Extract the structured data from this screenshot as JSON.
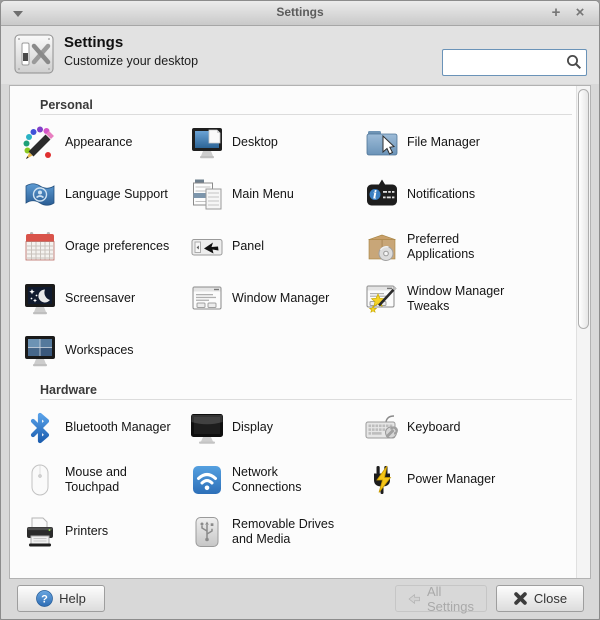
{
  "window": {
    "title": "Settings",
    "maximize_glyph": "+",
    "close_glyph": "×"
  },
  "header": {
    "title": "Settings",
    "subtitle": "Customize your desktop",
    "search_value": ""
  },
  "sections": [
    {
      "title": "Personal",
      "items": [
        {
          "label": "Appearance",
          "icon": "appearance-icon"
        },
        {
          "label": "Desktop",
          "icon": "desktop-icon"
        },
        {
          "label": "File Manager",
          "icon": "file-manager-icon"
        },
        {
          "label": "Language Support",
          "icon": "language-support-icon"
        },
        {
          "label": "Main Menu",
          "icon": "main-menu-icon"
        },
        {
          "label": "Notifications",
          "icon": "notifications-icon"
        },
        {
          "label": "Orage preferences",
          "icon": "calendar-icon"
        },
        {
          "label": "Panel",
          "icon": "panel-icon"
        },
        {
          "label": "Preferred Applications",
          "icon": "preferred-applications-icon"
        },
        {
          "label": "Screensaver",
          "icon": "screensaver-icon"
        },
        {
          "label": "Window Manager",
          "icon": "window-manager-icon"
        },
        {
          "label": "Window Manager Tweaks",
          "icon": "window-manager-tweaks-icon"
        },
        {
          "label": "Workspaces",
          "icon": "workspaces-icon"
        }
      ]
    },
    {
      "title": "Hardware",
      "items": [
        {
          "label": "Bluetooth Manager",
          "icon": "bluetooth-icon"
        },
        {
          "label": "Display",
          "icon": "display-icon"
        },
        {
          "label": "Keyboard",
          "icon": "keyboard-icon"
        },
        {
          "label": "Mouse and Touchpad",
          "icon": "mouse-icon"
        },
        {
          "label": "Network Connections",
          "icon": "network-icon"
        },
        {
          "label": "Power Manager",
          "icon": "power-icon"
        },
        {
          "label": "Printers",
          "icon": "printer-icon"
        },
        {
          "label": "Removable Drives and Media",
          "icon": "removable-drive-icon"
        }
      ]
    }
  ],
  "footer": {
    "help_label": "Help",
    "all_settings_label": "All Settings",
    "all_settings_enabled": false,
    "close_label": "Close"
  },
  "colors": {
    "accent_blue": "#3a7fc2",
    "panel_bg": "#fcfcfc",
    "window_bg": "#d8d8d8",
    "search_border": "#6a93b8"
  }
}
